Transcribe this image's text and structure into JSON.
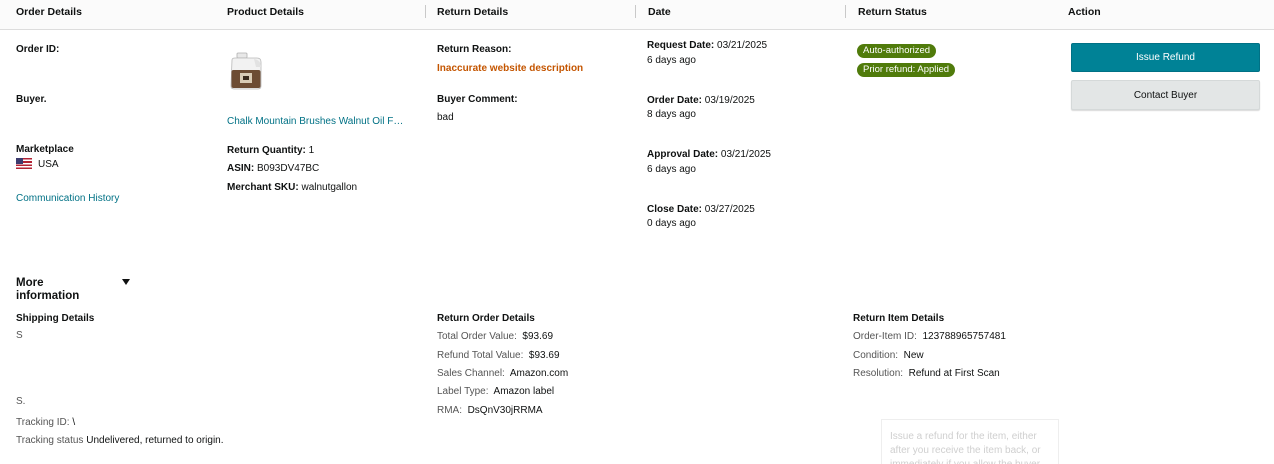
{
  "header": {
    "order_details": "Order Details",
    "product_details": "Product Details",
    "return_details": "Return Details",
    "date": "Date",
    "return_status": "Return Status",
    "action": "Action"
  },
  "order": {
    "order_id_label": "Order ID:",
    "buyer_label": "Buyer.",
    "marketplace_label": "Marketplace",
    "marketplace_value": "USA",
    "comm_history": "Communication History"
  },
  "product": {
    "image_icon": "jug-product-image",
    "title": "Chalk Mountain Brushes Walnut Oil F…",
    "return_qty_label": "Return Quantity:",
    "return_qty_value": "1",
    "asin_label": "ASIN:",
    "asin_value": "B093DV47BC",
    "sku_label": "Merchant SKU:",
    "sku_value": "walnutgallon"
  },
  "return": {
    "reason_label": "Return Reason:",
    "reason_value": "Inaccurate website description",
    "comment_label": "Buyer Comment:",
    "comment_value": "bad"
  },
  "dates": {
    "request_label": "Request Date:",
    "request_value": "03/21/2025",
    "request_ago": "6 days ago",
    "order_label": "Order Date:",
    "order_value": "03/19/2025",
    "order_ago": "8 days ago",
    "approval_label": "Approval Date:",
    "approval_value": "03/21/2025",
    "approval_ago": "6 days ago",
    "close_label": "Close Date:",
    "close_value": "03/27/2025",
    "close_ago": "0 days ago"
  },
  "status": {
    "badge1": "Auto-authorized",
    "badge2": "Prior refund: Applied",
    "badge_color": "#507b0b"
  },
  "actions": {
    "issue_refund": "Issue Refund",
    "contact_buyer": "Contact Buyer",
    "primary_color": "#008296"
  },
  "more": {
    "title": "More information",
    "shipping_title": "Shipping Details",
    "ship_s1": "S",
    "ship_s2": "S.",
    "tracking_id_label": "Tracking ID:",
    "tracking_id_value": "\\",
    "tracking_status_label": "Tracking status",
    "tracking_status_value": "Undelivered, returned to origin.",
    "order_details_title": "Return Order Details",
    "total_order_label": "Total Order Value:",
    "total_order_value": "$93.69",
    "refund_total_label": "Refund Total Value:",
    "refund_total_value": "$93.69",
    "sales_channel_label": "Sales Channel:",
    "sales_channel_value": "Amazon.com",
    "label_type_label": "Label Type:",
    "label_type_value": "Amazon label",
    "rma_label": "RMA:",
    "rma_value": "DsQnV30jRRMA",
    "item_details_title": "Return Item Details",
    "order_item_label": "Order-Item ID:",
    "order_item_value": "123788965757481",
    "condition_label": "Condition:",
    "condition_value": "New",
    "resolution_label": "Resolution:",
    "resolution_value": "Refund at First Scan"
  },
  "tooltip": {
    "text": "Issue a refund for the item, either after you receive the item back, or immediately if you allow the buyer"
  }
}
